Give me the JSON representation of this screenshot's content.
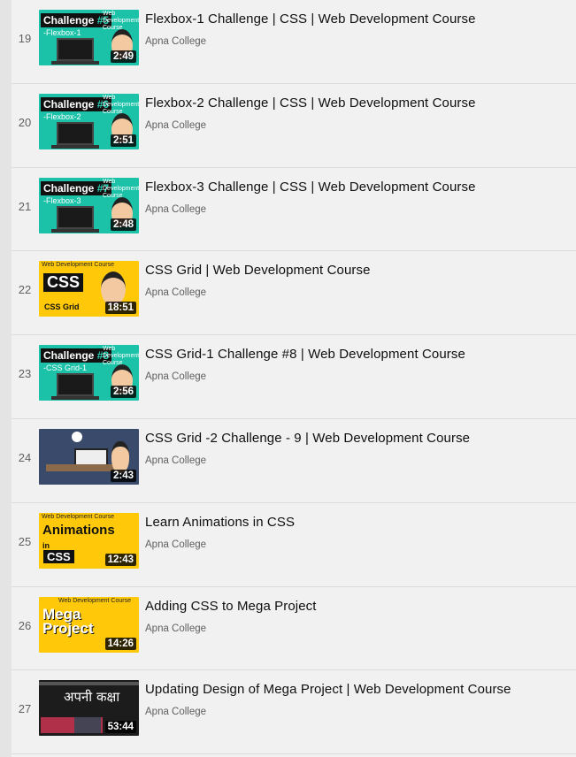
{
  "videos": [
    {
      "index": "19",
      "title": "Flexbox-1 Challenge | CSS | Web Development Course",
      "channel": "Apna College",
      "duration": "2:49",
      "thumb": {
        "style": "teal",
        "badge": "Challenge",
        "num": "#5",
        "sub": "-Flexbox-1",
        "tag": "Web Development Course"
      }
    },
    {
      "index": "20",
      "title": "Flexbox-2 Challenge | CSS | Web Development Course",
      "channel": "Apna College",
      "duration": "2:51",
      "thumb": {
        "style": "teal",
        "badge": "Challenge",
        "num": "#6",
        "sub": "-Flexbox-2",
        "tag": "Web Development Course"
      }
    },
    {
      "index": "21",
      "title": "Flexbox-3 Challenge | CSS | Web Development Course",
      "channel": "Apna College",
      "duration": "2:48",
      "thumb": {
        "style": "teal",
        "badge": "Challenge",
        "num": "#7",
        "sub": "-Flexbox-3",
        "tag": "Web Development Course"
      }
    },
    {
      "index": "22",
      "title": "CSS Grid | Web Development Course",
      "channel": "Apna College",
      "duration": "18:51",
      "thumb": {
        "style": "yellow-css",
        "header": "Web Development Course",
        "big": "CSS",
        "foot": "CSS Grid"
      }
    },
    {
      "index": "23",
      "title": "CSS Grid-1 Challenge #8 | Web Development Course",
      "channel": "Apna College",
      "duration": "2:56",
      "thumb": {
        "style": "teal",
        "badge": "Challenge",
        "num": "#8",
        "sub": "-CSS Grid-1",
        "tag": "Web Development Course"
      }
    },
    {
      "index": "24",
      "title": "CSS Grid -2 Challenge - 9 | Web Development Course",
      "channel": "Apna College",
      "duration": "2:43",
      "thumb": {
        "style": "room"
      }
    },
    {
      "index": "25",
      "title": "Learn Animations in CSS",
      "channel": "Apna College",
      "duration": "12:43",
      "thumb": {
        "style": "yellow-anim",
        "header": "Web Development Course",
        "big": "Animations",
        "small": "in",
        "css": "CSS"
      }
    },
    {
      "index": "26",
      "title": "Adding CSS to Mega Project",
      "channel": "Apna College",
      "duration": "14:26",
      "thumb": {
        "style": "yellow-mega",
        "header": "Web Development Course",
        "big": "Mega",
        "big2": "Project"
      }
    },
    {
      "index": "27",
      "title": "Updating Design of Mega Project | Web Development Course",
      "channel": "Apna College",
      "duration": "53:44",
      "thumb": {
        "style": "dark",
        "deva": "अपनी कक्षा"
      }
    }
  ]
}
